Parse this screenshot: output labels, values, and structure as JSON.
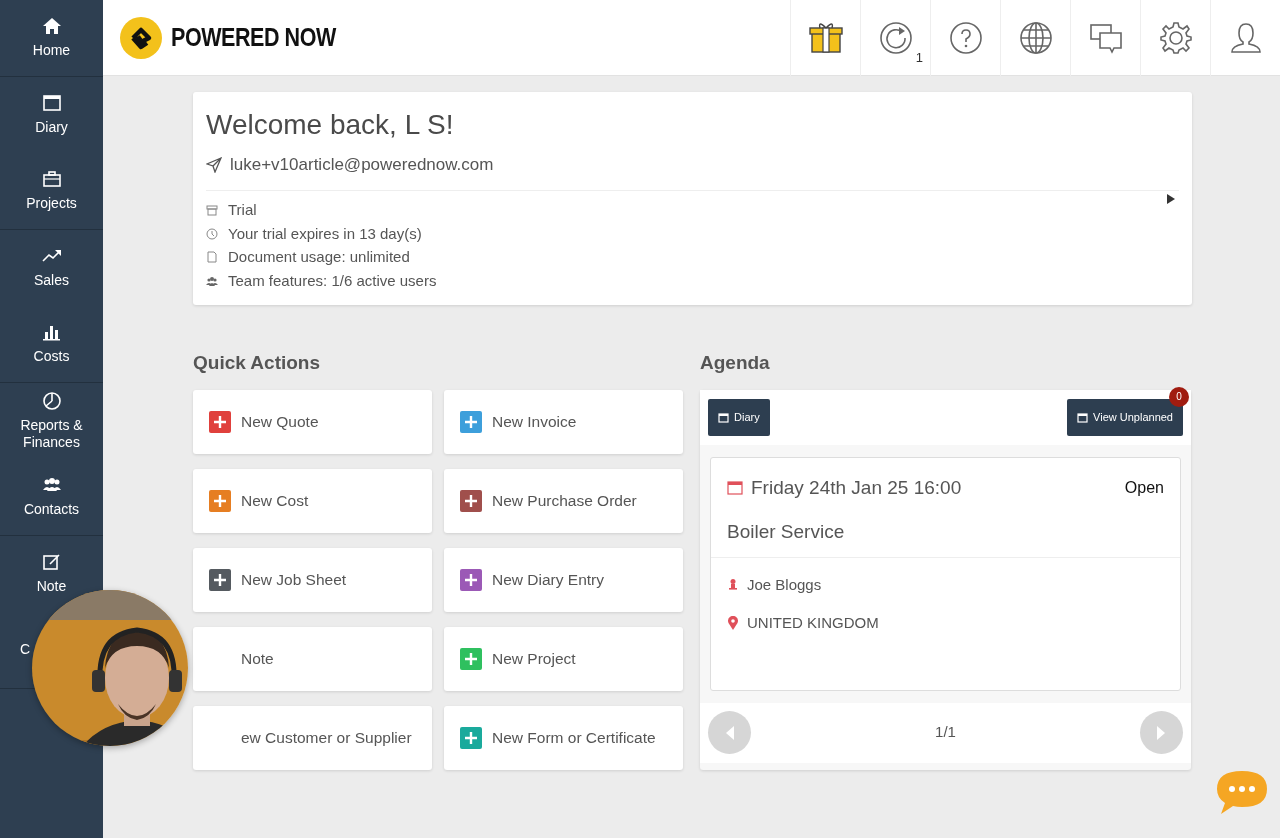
{
  "sidebar": {
    "groups": [
      {
        "items": [
          {
            "label": "Home"
          }
        ]
      },
      {
        "items": [
          {
            "label": "Diary"
          },
          {
            "label": "Projects"
          }
        ]
      },
      {
        "items": [
          {
            "label": "Sales"
          },
          {
            "label": "Costs"
          }
        ]
      },
      {
        "items": [
          {
            "label": "Reports & Finances"
          },
          {
            "label": "Contacts"
          }
        ]
      },
      {
        "items": [
          {
            "label": "Note"
          },
          {
            "label": "C",
            "clipped": true
          }
        ]
      }
    ]
  },
  "header": {
    "logo_text": "POWERED NOW",
    "sync_count": "1"
  },
  "welcome": {
    "title": "Welcome back, L S!",
    "email": "luke+v10article@powerednow.com",
    "details": [
      "Trial",
      "Your trial expires in 13 day(s)",
      "Document usage: unlimited",
      "Team features: 1/6 active users"
    ]
  },
  "quick_actions": {
    "title": "Quick Actions",
    "items": [
      {
        "label": "New Quote",
        "color": "#e0403c"
      },
      {
        "label": "New Invoice",
        "color": "#3d9fdb"
      },
      {
        "label": "New Cost",
        "color": "#e67e22"
      },
      {
        "label": "New Purchase Order",
        "color": "#a04f4c"
      },
      {
        "label": "New Job Sheet",
        "color": "#555a60"
      },
      {
        "label": "New Diary Entry",
        "color": "#9b59b6"
      },
      {
        "label": "Note"
      },
      {
        "label": "New Project",
        "color": "#2fc05f"
      },
      {
        "label": "ew Customer or Supplier"
      },
      {
        "label": "New Form or Certificate",
        "color": "#1aaa9c"
      }
    ]
  },
  "agenda": {
    "title": "Agenda",
    "diary_button": "Diary",
    "unplanned_button": "View Unplanned",
    "unplanned_count": "0",
    "event": {
      "date": "Friday 24th Jan 25 16:00",
      "status": "Open",
      "title": "Boiler Service",
      "contact": "Joe Bloggs",
      "location": "UNITED KINGDOM"
    },
    "pager": {
      "text": "1/1",
      "prev_disabled": true,
      "next_disabled": true
    }
  }
}
